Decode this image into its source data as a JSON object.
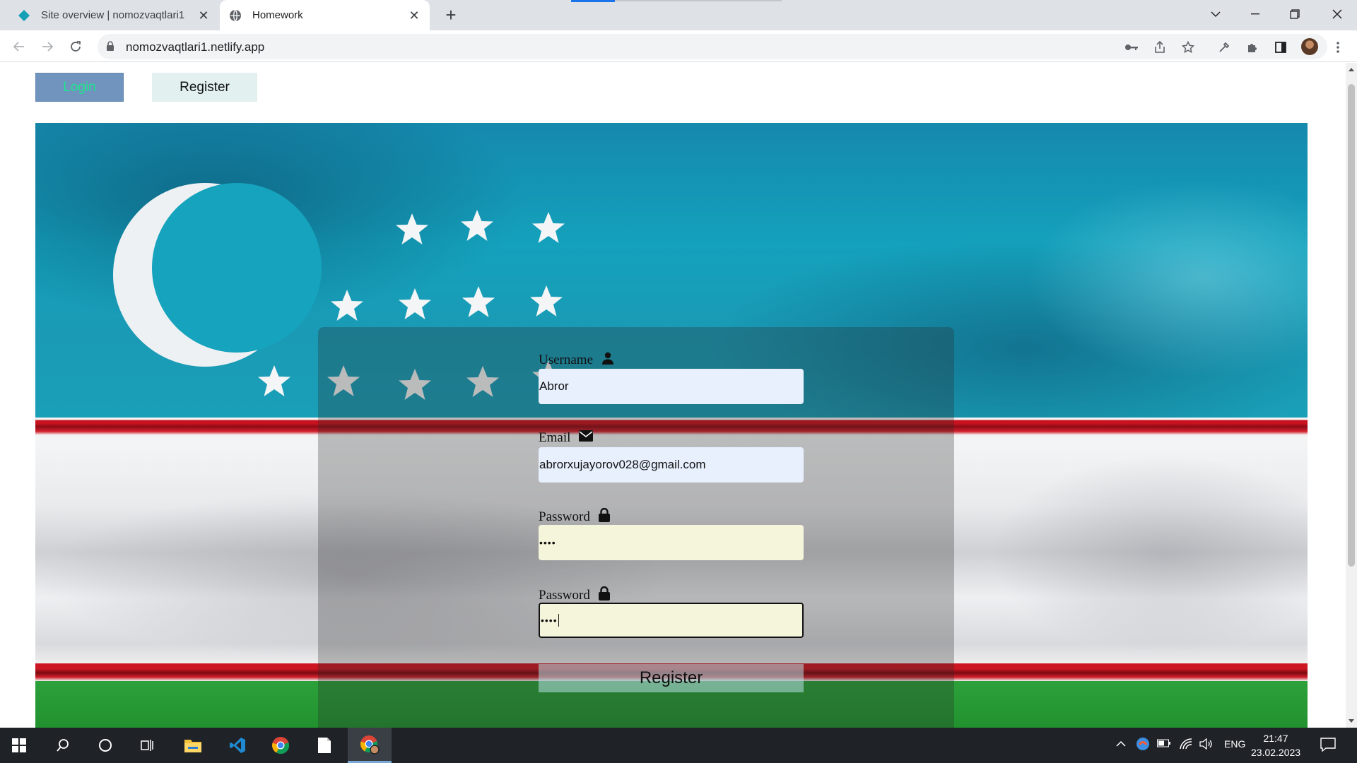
{
  "browser": {
    "tabs": [
      {
        "title": "Site overview | nomozvaqtlari1",
        "active": false
      },
      {
        "title": "Homework",
        "active": true
      }
    ],
    "url": "nomozvaqtlari1.netlify.app"
  },
  "nav": {
    "login_label": "Login",
    "register_label": "Register"
  },
  "form": {
    "username_label": "Username",
    "username_value": "Abror",
    "email_label": "Email",
    "email_value": "abrorxujayorov028@gmail.com",
    "password_label": "Password",
    "password_value": "••••",
    "confirm_label": "Password",
    "confirm_value": "••••",
    "submit_label": "Register"
  },
  "taskbar": {
    "language": "ENG",
    "time": "21:47",
    "date": "23.02.2023"
  },
  "colors": {
    "login_bg": "#7094be",
    "login_text": "#21e28e",
    "register_bg": "#e2f1f0",
    "autofill_bg": "#e8f0fe",
    "password_bg": "#f5f5dc"
  }
}
